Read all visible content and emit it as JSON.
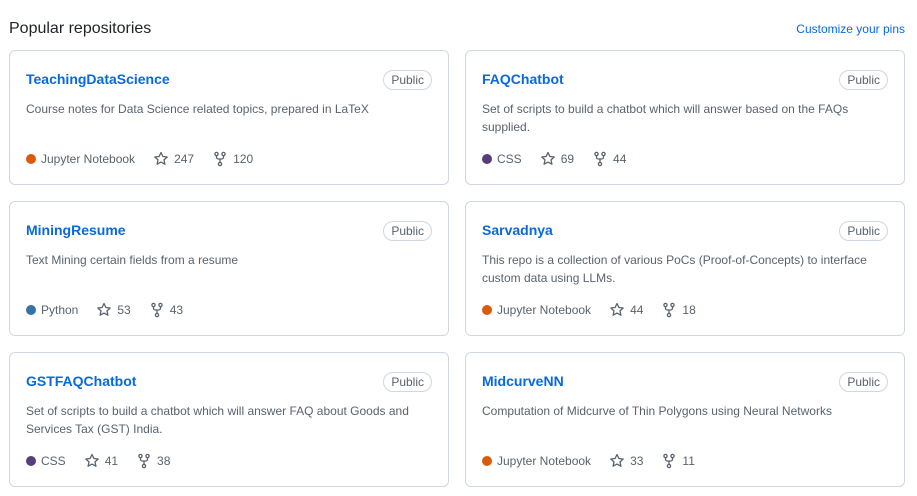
{
  "header": {
    "title": "Popular repositories",
    "customize_label": "Customize your pins"
  },
  "repos": [
    {
      "name": "TeachingDataScience",
      "visibility": "Public",
      "description": "Course notes for Data Science related topics, prepared in LaTeX",
      "language": "Jupyter Notebook",
      "language_color": "#DA5B0B",
      "stars": "247",
      "forks": "120"
    },
    {
      "name": "FAQChatbot",
      "visibility": "Public",
      "description": "Set of scripts to build a chatbot which will answer based on the FAQs supplied.",
      "language": "CSS",
      "language_color": "#563d7c",
      "stars": "69",
      "forks": "44"
    },
    {
      "name": "MiningResume",
      "visibility": "Public",
      "description": "Text Mining certain fields from a resume",
      "language": "Python",
      "language_color": "#3572A5",
      "stars": "53",
      "forks": "43"
    },
    {
      "name": "Sarvadnya",
      "visibility": "Public",
      "description": "This repo is a collection of various PoCs (Proof-of-Concepts) to interface custom data using LLMs.",
      "language": "Jupyter Notebook",
      "language_color": "#DA5B0B",
      "stars": "44",
      "forks": "18"
    },
    {
      "name": "GSTFAQChatbot",
      "visibility": "Public",
      "description": "Set of scripts to build a chatbot which will answer FAQ about Goods and Services Tax (GST) India.",
      "language": "CSS",
      "language_color": "#563d7c",
      "stars": "41",
      "forks": "38"
    },
    {
      "name": "MidcurveNN",
      "visibility": "Public",
      "description": "Computation of Midcurve of Thin Polygons using Neural Networks",
      "language": "Jupyter Notebook",
      "language_color": "#DA5B0B",
      "stars": "33",
      "forks": "11"
    }
  ]
}
